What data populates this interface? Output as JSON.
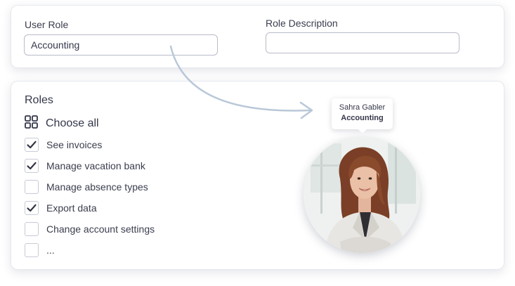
{
  "user_role": {
    "label": "User Role",
    "value": "Accounting"
  },
  "role_description": {
    "label": "Role Description",
    "value": ""
  },
  "roles": {
    "title": "Roles",
    "choose_all_label": "Choose all",
    "items": [
      {
        "label": "See invoices",
        "checked": true
      },
      {
        "label": "Manage vacation bank",
        "checked": true
      },
      {
        "label": "Manage absence types",
        "checked": false
      },
      {
        "label": "Export data",
        "checked": true
      },
      {
        "label": "Change account settings",
        "checked": false
      },
      {
        "label": "...",
        "checked": false
      }
    ]
  },
  "user_card": {
    "name": "Sahra Gabler",
    "role": "Accounting"
  },
  "colors": {
    "accent_arrow": "#b9c8d8",
    "checkmark": "#2f3342",
    "border": "#b7bcc8"
  },
  "icons": {
    "choose_all": "grid-icon",
    "check": "checkmark-icon"
  }
}
